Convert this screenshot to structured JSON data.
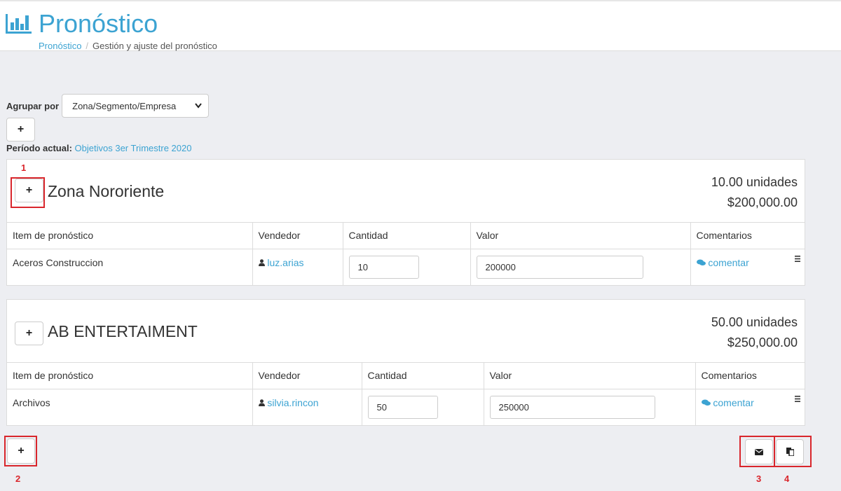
{
  "header": {
    "title": "Pronóstico",
    "breadcrumb": {
      "link": "Pronóstico",
      "separator": "/",
      "current": "Gestión y ajuste del pronóstico"
    }
  },
  "controls": {
    "group_label": "Agrupar por",
    "group_value": "Zona/Segmento/Empresa",
    "add_label": "+"
  },
  "period": {
    "label": "Período actual:",
    "value": "Objetivos 3er Trimestre 2020"
  },
  "columns": [
    "Item de pronóstico",
    "Vendedor",
    "Cantidad",
    "Valor",
    "Comentarios"
  ],
  "groups": [
    {
      "name": "Zona Nororiente",
      "units": "10.00 unidades",
      "amount": "$200,000.00",
      "row": {
        "item": "Aceros Construccion",
        "seller": "luz.arias",
        "qty": "10",
        "value": "200000",
        "comment": "comentar"
      }
    },
    {
      "name": "AB ENTERTAIMENT",
      "units": "50.00 unidades",
      "amount": "$250,000.00",
      "row": {
        "item": "Archivos",
        "seller": "silvia.rincon",
        "qty": "50",
        "value": "250000",
        "comment": "comentar"
      }
    }
  ],
  "annotations": [
    "1",
    "2",
    "3",
    "4"
  ],
  "colors": {
    "accent": "#3ca3d2",
    "highlight": "#d9262c"
  }
}
